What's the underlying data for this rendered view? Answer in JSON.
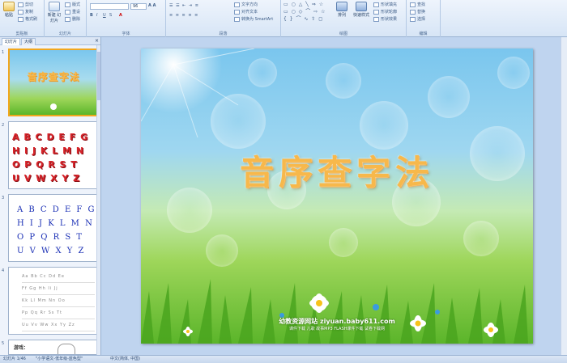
{
  "ribbon": {
    "clipboard": {
      "paste": "粘贴",
      "cut": "剪切",
      "copy": "复制",
      "format_painter": "格式刷",
      "label": "剪贴板"
    },
    "slides": {
      "new_slide": "新建\n幻灯片",
      "layout": "版式",
      "reset": "重设",
      "delete": "删除",
      "label": "幻灯片"
    },
    "font": {
      "size": "96",
      "label": "字体"
    },
    "paragraph": {
      "text_direction": "文字方向",
      "align_text": "对齐文本",
      "convert_smartart": "转换为 SmartArt",
      "label": "段落"
    },
    "drawing": {
      "arrange": "排列",
      "quick_styles": "快速样式",
      "shape_fill": "形状填充",
      "shape_outline": "形状轮廓",
      "shape_effects": "形状效果",
      "label": "绘图"
    },
    "editing": {
      "find": "查找",
      "replace": "替换",
      "select": "选择",
      "label": "编辑"
    }
  },
  "panel": {
    "tab_slides": "幻灯片",
    "tab_outline": "大纲",
    "close": "×",
    "thumbs": [
      {
        "num": "1",
        "title": "音序查字法"
      },
      {
        "num": "2",
        "letters": [
          "A B C D E F G",
          "H I J K L M N",
          "O P Q R S T",
          "U V W X Y Z"
        ]
      },
      {
        "num": "3",
        "letters": [
          "A B C D E F G",
          "H I J K L M N",
          "O P Q R S T",
          "U V W X Y Z"
        ]
      },
      {
        "num": "4",
        "rows": [
          "Aa Bb Cc Dd Ee",
          "Ff Gg Hh Ii Jj",
          "Kk Ll Mm Nn Oo",
          "Pp Qq Rr Ss Tt",
          "Uu Vv Ww Xx Yy Zz"
        ]
      },
      {
        "num": "5",
        "label": "游戏："
      }
    ]
  },
  "slide": {
    "title": "音序查字法",
    "site_line": "幼教资源网站  ziyuan.baby611.com",
    "sub_line": "课件下载  儿歌  故事MP3  FLASH课件下载  试卷下载网"
  },
  "status": {
    "slide_count": "幻灯片 1/46",
    "template": "\"小学语文-低年级-蓝色型\"",
    "language": "中文(简体, 中国)"
  },
  "colors": {
    "title": "#f7b84b",
    "ribbon": "#d7e5f6",
    "selection": "#f2a71e"
  }
}
